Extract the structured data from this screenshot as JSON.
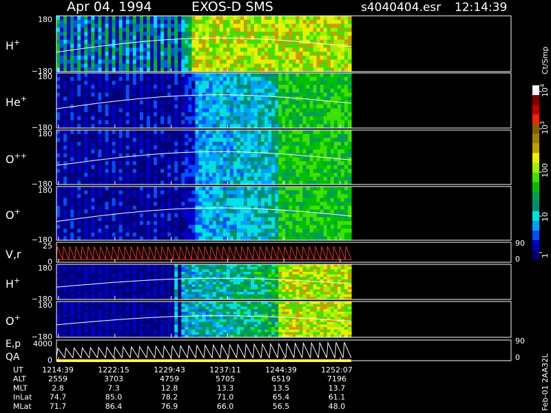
{
  "chart_data": {
    "type": "heatmap",
    "title": "Apr 04, 1994",
    "instrument": "EXOS-D SMS",
    "file": "s4040404.esr",
    "clock": "12:14:39",
    "colorbar": {
      "unit": "Ct/Smp",
      "tick_labels": [
        "1",
        "10",
        "100",
        "10",
        "10"
      ],
      "tick_exponents": [
        "",
        "",
        "",
        "3",
        "4"
      ],
      "scale": "log",
      "colors": [
        "#00007a",
        "#0000c8",
        "#0050ff",
        "#00a0ff",
        "#00e0e0",
        "#008c78",
        "#00a050",
        "#00c000",
        "#40e000",
        "#a0f000",
        "#e8f000",
        "#c0a000",
        "#a08000",
        "#806000",
        "#ff2000",
        "#c00000",
        "#800000",
        "#ffffff"
      ]
    },
    "panels": [
      {
        "key": "h1",
        "label": "H",
        "sup": "+",
        "ymax": "180",
        "ymin": "−180",
        "kind": "pitch"
      },
      {
        "key": "he",
        "label": "He",
        "sup": "+",
        "ymax": "180",
        "ymin": "−180",
        "kind": "pitch"
      },
      {
        "key": "opp",
        "label": "O",
        "sup": "++",
        "ymax": "180",
        "ymin": "−180",
        "kind": "pitch"
      },
      {
        "key": "o1",
        "label": "O",
        "sup": "+",
        "ymax": "180",
        "ymin": "−180",
        "kind": "pitch"
      },
      {
        "key": "vr",
        "label": "V,r",
        "ymax": "25",
        "ymin": "0",
        "right_max": "90",
        "right_min": "0",
        "kind": "trace"
      },
      {
        "key": "h2",
        "label": "H",
        "sup": "+",
        "ymax": "180",
        "ymin": "−180",
        "kind": "pitch"
      },
      {
        "key": "o2",
        "label": "O",
        "sup": "+",
        "ymax": "180",
        "ymin": "−180",
        "kind": "pitch"
      },
      {
        "key": "ep",
        "label": "E,p",
        "label2": "QA",
        "ymax": "4000",
        "ymin": "0",
        "right_max": "90",
        "right_min": "0",
        "kind": "trace"
      }
    ],
    "x_axis": {
      "rows": [
        {
          "name": "UT",
          "values": [
            "1214:39",
            "1222:15",
            "1229:43",
            "1237:11",
            "1244:39",
            "1252:07"
          ]
        },
        {
          "name": "ALT",
          "values": [
            "2559",
            "3703",
            "4759",
            "5705",
            "6519",
            "7196"
          ]
        },
        {
          "name": "MLT",
          "values": [
            "2.8",
            "7.3",
            "12.8",
            "13.3",
            "13.5",
            "13.7"
          ]
        },
        {
          "name": "InLat",
          "values": [
            "74.7",
            "85.0",
            "78.2",
            "71.0",
            "65.4",
            "61.1"
          ]
        },
        {
          "name": "MLat",
          "values": [
            "71.7",
            "86.4",
            "76.9",
            "66.0",
            "56.5",
            "48.0"
          ]
        }
      ]
    },
    "footer_code": "Feb-01 2AA32L"
  }
}
